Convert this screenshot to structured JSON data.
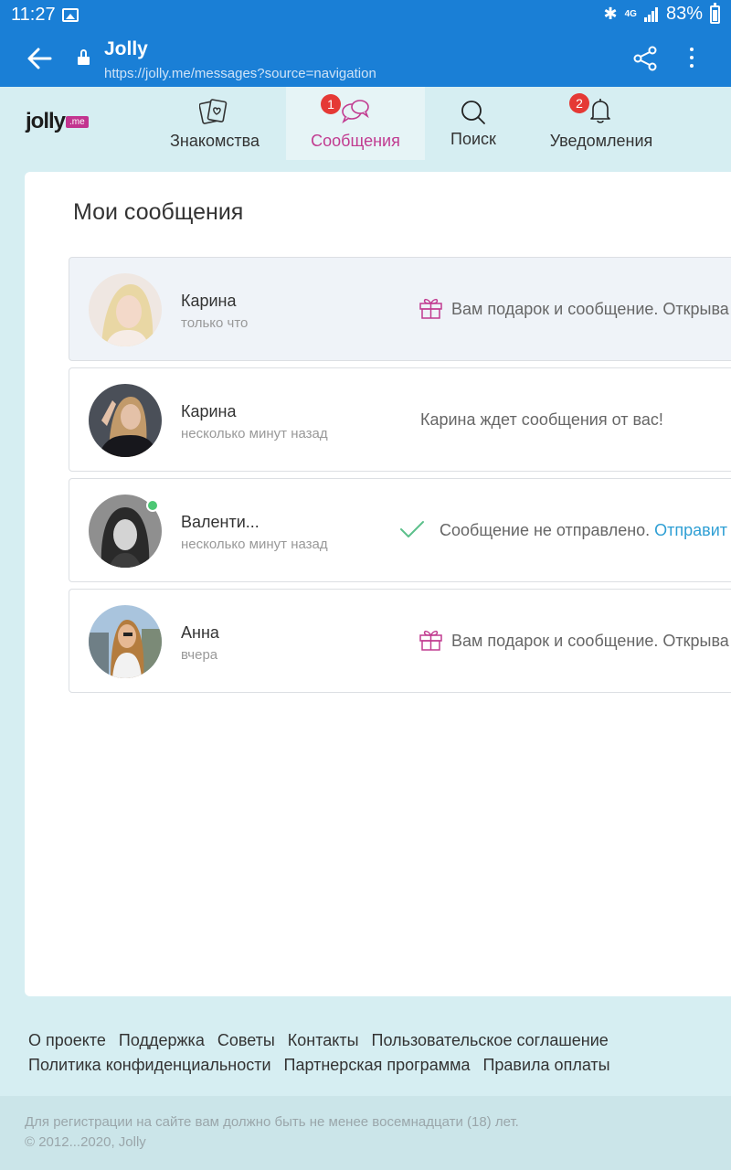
{
  "statusbar": {
    "time": "11:27",
    "network": "4G",
    "battery": "83%"
  },
  "browser": {
    "title": "Jolly",
    "url": "https://jolly.me/messages?source=navigation"
  },
  "logo": {
    "text": "jolly",
    "badge": ".me"
  },
  "nav": [
    {
      "label": "Знакомства",
      "badge": ""
    },
    {
      "label": "Сообщения",
      "badge": "1"
    },
    {
      "label": "Поиск",
      "badge": ""
    },
    {
      "label": "Уведомления",
      "badge": "2"
    }
  ],
  "colors": {
    "primary": "#1a7fd6",
    "accent": "#c13b90",
    "link": "#2f9fd4",
    "online": "#4cc774",
    "badge": "#e53935"
  },
  "page_title": "Мои сообщения",
  "chats": [
    {
      "name": "Карина",
      "time": "только что",
      "preview": "Вам подарок и сообщение. Открыва"
    },
    {
      "name": "Карина",
      "time": "несколько минут назад",
      "preview": "Карина ждет сообщения от вас!"
    },
    {
      "name": "Валенти...",
      "time": "несколько минут назад",
      "preview": "Сообщение не отправлено.",
      "link": "Отправит"
    },
    {
      "name": "Анна",
      "time": "вчера",
      "preview": "Вам подарок и сообщение. Открыва"
    }
  ],
  "footer": {
    "row1": [
      "О проекте",
      "Поддержка",
      "Советы",
      "Контакты",
      "Пользовательское соглашение"
    ],
    "row2": [
      "Политика конфиденциальности",
      "Партнерская программа",
      "Правила оплаты"
    ],
    "legal": "Для регистрации на сайте вам должно быть не менее восемнадцати (18) лет.",
    "copyright": "© 2012...2020, Jolly"
  }
}
